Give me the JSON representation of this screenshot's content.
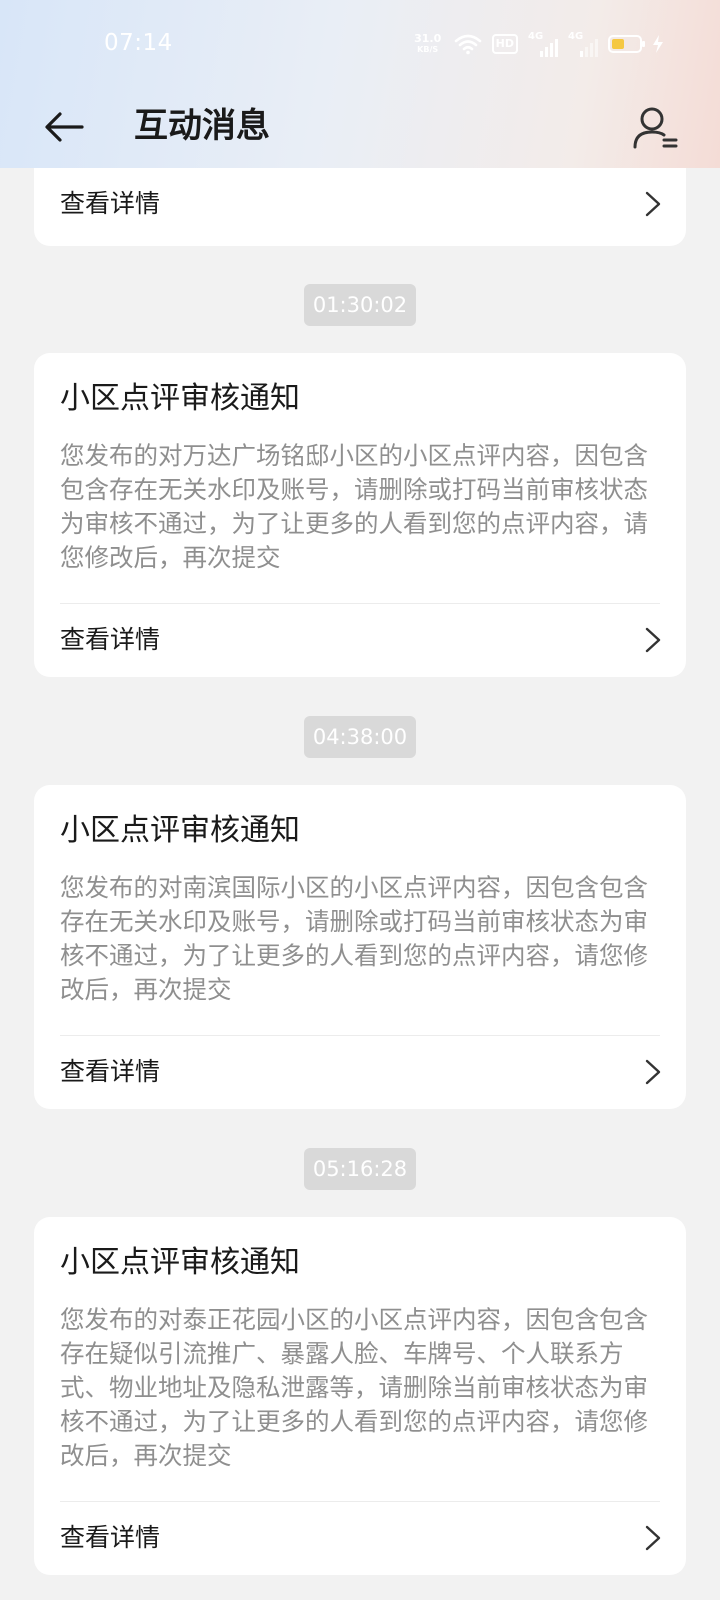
{
  "status_bar": {
    "time": "07:14",
    "net_speed_value": "31.0",
    "net_speed_unit": "KB/S",
    "hd_label": "HD",
    "signal1_label": "4G",
    "signal2_label": "4G",
    "battery_level": 0.45,
    "battery_color": "#f5c842"
  },
  "header": {
    "title": "互动消息",
    "back_icon": "arrow-left-icon",
    "user_icon": "user-settings-icon"
  },
  "top_partial_card": {
    "detail_label": "查看详情"
  },
  "messages": [
    {
      "timestamp": "01:30:02",
      "title": "小区点评审核通知",
      "body": "您发布的对万达广场铭邸小区的小区点评内容，因包含包含存在无关水印及账号，请删除或打码当前审核状态为审核不通过，为了让更多的人看到您的点评内容，请您修改后，再次提交",
      "detail_label": "查看详情"
    },
    {
      "timestamp": "04:38:00",
      "title": "小区点评审核通知",
      "body": "您发布的对南滨国际小区的小区点评内容，因包含包含存在无关水印及账号，请删除或打码当前审核状态为审核不通过，为了让更多的人看到您的点评内容，请您修改后，再次提交",
      "detail_label": "查看详情"
    },
    {
      "timestamp": "05:16:28",
      "title": "小区点评审核通知",
      "body": "您发布的对泰正花园小区的小区点评内容，因包含包含存在疑似引流推广、暴露人脸、车牌号、个人联系方式、物业地址及隐私泄露等，请删除当前审核状态为审核不通过，为了让更多的人看到您的点评内容，请您修改后，再次提交",
      "detail_label": "查看详情"
    }
  ]
}
